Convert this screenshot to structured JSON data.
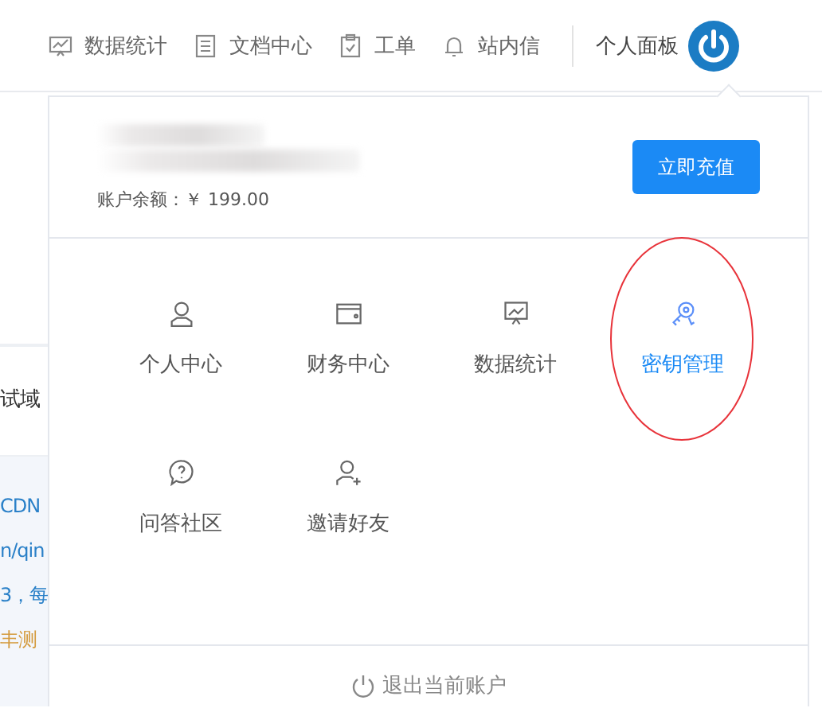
{
  "nav": {
    "items": [
      {
        "label": "数据统计",
        "kind": "chart"
      },
      {
        "label": "文档中心",
        "kind": "doc"
      },
      {
        "label": "工单",
        "kind": "clipboard"
      },
      {
        "label": "站内信",
        "kind": "bell"
      }
    ],
    "profile_label": "个人面板"
  },
  "background": {
    "texts": [
      {
        "text": "试域",
        "kind": "plain"
      },
      {
        "text": "CDN",
        "kind": "link"
      },
      {
        "text": "n/qin",
        "kind": "link"
      },
      {
        "text": "3，每",
        "kind": "link"
      },
      {
        "text": "丰测",
        "kind": "warn"
      }
    ]
  },
  "panel": {
    "balance_label": "账户余额：",
    "balance": "￥ 199.00",
    "recharge_button": "立即充值",
    "menu": [
      {
        "label": "个人中心",
        "kind": "user",
        "selected": false,
        "circled": false
      },
      {
        "label": "财务中心",
        "kind": "wallet",
        "selected": false,
        "circled": false
      },
      {
        "label": "数据统计",
        "kind": "presentation",
        "selected": false,
        "circled": false
      },
      {
        "label": "密钥管理",
        "kind": "key",
        "selected": true,
        "circled": true
      },
      {
        "label": "问答社区",
        "kind": "question",
        "selected": false,
        "circled": false
      },
      {
        "label": "邀请好友",
        "kind": "user-plus",
        "selected": false,
        "circled": false
      }
    ],
    "logout": "退出当前账户"
  }
}
